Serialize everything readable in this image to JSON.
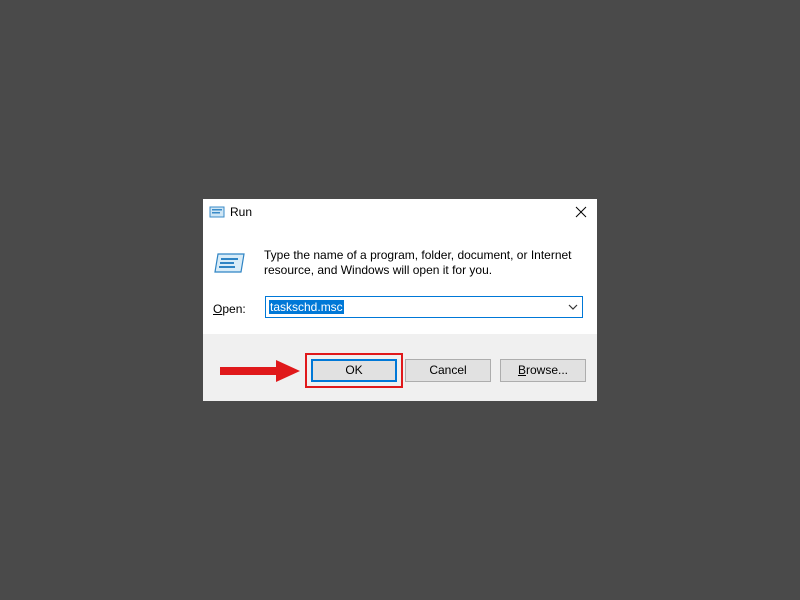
{
  "dialog": {
    "title": "Run",
    "title_icon": "run-icon",
    "close_icon": "close-icon",
    "big_icon": "run-icon",
    "description": "Type the name of a program, folder, document, or Internet resource, and Windows will open it for you.",
    "open_label_mnemonic": "O",
    "open_label_rest": "pen:",
    "combo_value": "taskschd.msc",
    "combo_arrow_icon": "chevron-down-icon"
  },
  "buttons": {
    "ok_label": "OK",
    "cancel_label": "Cancel",
    "browse_mnemonic": "B",
    "browse_rest": "rowse..."
  },
  "annotation": {
    "arrow_icon": "red-arrow-icon",
    "highlight_color": "#e0191b"
  },
  "colors": {
    "desktop": "#4a4a4a",
    "accent": "#0078d7",
    "dialog_body": "#f0f0f0"
  }
}
